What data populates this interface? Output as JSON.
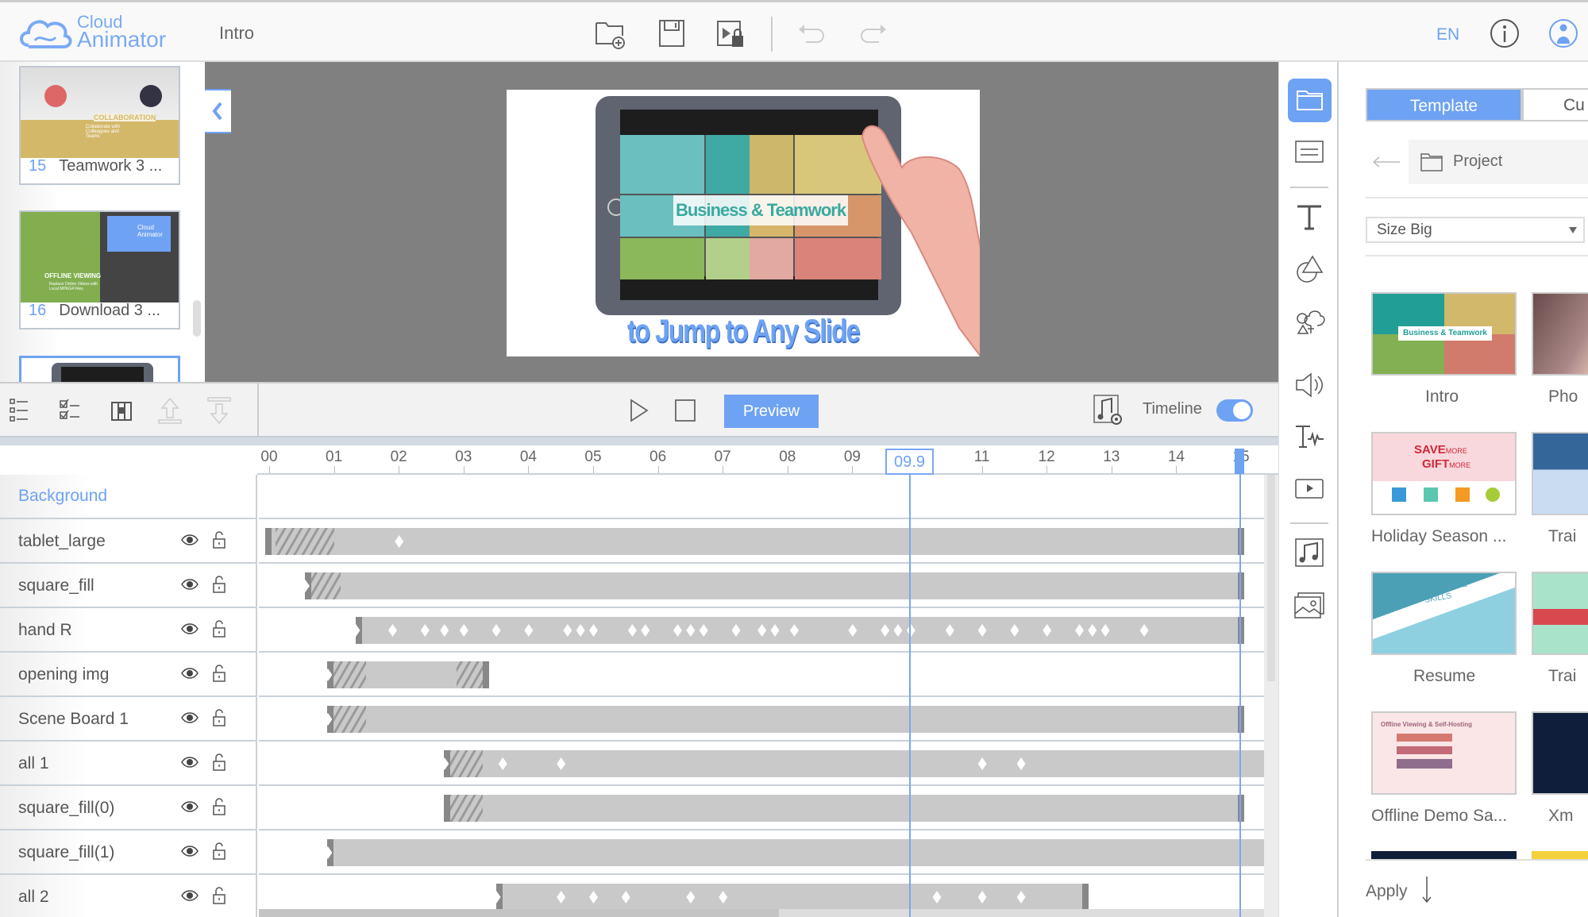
{
  "app": {
    "logo_line1": "Cloud",
    "logo_line2": "Animator",
    "project_title": "Intro",
    "language": "EN"
  },
  "slides": [
    {
      "number": "15",
      "title": "Teamwork 3 ...",
      "caption": "COLLABORATION",
      "subcaption": "Collaborate with Colleagues and Teams"
    },
    {
      "number": "16",
      "title": "Download 3 ...",
      "caption": "OFFLINE VIEWING",
      "subcaption": "Replace Online Videos with Local MPEG4 Files",
      "logo1": "Cloud",
      "logo2": "Animator"
    }
  ],
  "stage": {
    "banner": "Business & Teamwork",
    "caption": "to Jump to Any Slide",
    "accent": "#6ea2f3"
  },
  "toolbar": {
    "preview_label": "Preview",
    "timeline_label": "Timeline",
    "timeline_enabled": true
  },
  "timeline": {
    "current_time": "09.9",
    "duration": 15,
    "tick_labels": [
      "00",
      "01",
      "02",
      "03",
      "04",
      "05",
      "06",
      "07",
      "08",
      "09",
      "",
      "11",
      "12",
      "13",
      "14",
      "15"
    ],
    "background_label": "Background",
    "tracks": [
      {
        "name": "tablet_large",
        "start": 0,
        "end": 15,
        "end_cap": true,
        "hatches": [
          [
            0,
            1.0
          ]
        ],
        "keys": [
          2.0
        ]
      },
      {
        "name": "square_fill",
        "start": 0.55,
        "end": 15,
        "end_cap": true,
        "hatches": [
          [
            0.55,
            1.1
          ]
        ],
        "keys": [
          0.55
        ]
      },
      {
        "name": "hand R",
        "start": 1.33,
        "end": 15,
        "end_cap": true,
        "hatches": [],
        "keys": [
          1.33,
          1.9,
          2.4,
          2.7,
          3.0,
          3.5,
          4.0,
          4.6,
          4.8,
          5.0,
          5.6,
          5.8,
          6.3,
          6.5,
          6.7,
          7.2,
          7.6,
          7.8,
          8.1,
          9.0,
          9.5,
          9.7,
          9.9,
          10.5,
          11.0,
          11.5,
          12.0,
          12.5,
          12.7,
          12.9,
          13.5
        ]
      },
      {
        "name": "opening img",
        "start": 0.9,
        "end": 3.35,
        "end_cap": true,
        "hatches": [
          [
            0.9,
            1.5
          ],
          [
            2.8,
            3.35
          ]
        ],
        "keys": [
          0.9
        ]
      },
      {
        "name": "Scene Board 1",
        "start": 0.9,
        "end": 15,
        "end_cap": true,
        "hatches": [
          [
            0.9,
            1.5
          ]
        ],
        "keys": [
          0.9
        ]
      },
      {
        "name": "all 1",
        "start": 2.7,
        "end": null,
        "end_cap": false,
        "hatches": [
          [
            2.7,
            3.3
          ]
        ],
        "keys": [
          2.7,
          3.6,
          4.5,
          11.0,
          11.6
        ]
      },
      {
        "name": "square_fill(0)",
        "start": 2.7,
        "end": 15,
        "end_cap": true,
        "hatches": [
          [
            2.7,
            3.3
          ]
        ],
        "keys": []
      },
      {
        "name": "square_fill(1)",
        "start": 0.9,
        "end": null,
        "end_cap": false,
        "hatches": [],
        "keys": [
          0.9
        ]
      },
      {
        "name": "all 2",
        "start": 3.5,
        "end": 12.6,
        "end_cap": true,
        "hatches": [],
        "keys": [
          3.5,
          4.5,
          5.0,
          5.5,
          6.5,
          7.0,
          10.3,
          11.0,
          11.6
        ]
      }
    ]
  },
  "panel": {
    "tabs": [
      {
        "label": "Template",
        "active": true
      },
      {
        "label": "Cu",
        "active": false
      }
    ],
    "breadcrumb": "Project",
    "size_select": "Size Big",
    "templates": [
      {
        "name": "Intro"
      },
      {
        "name": "Pho"
      },
      {
        "name": "Holiday Season ..."
      },
      {
        "name": "Trai"
      },
      {
        "name": "Resume"
      },
      {
        "name": "Trai"
      },
      {
        "name": "Offline Demo Sa..."
      },
      {
        "name": "Xm"
      }
    ],
    "thumb_texts": {
      "holiday1": "SAVE",
      "holiday2": "GIFT",
      "more": "MORE",
      "resume": "SOFTWARE SKILLS",
      "offline": "Offline Viewing & Self-Hosting",
      "intro_banner": "Business & Teamwork"
    },
    "apply_label": "Apply"
  }
}
